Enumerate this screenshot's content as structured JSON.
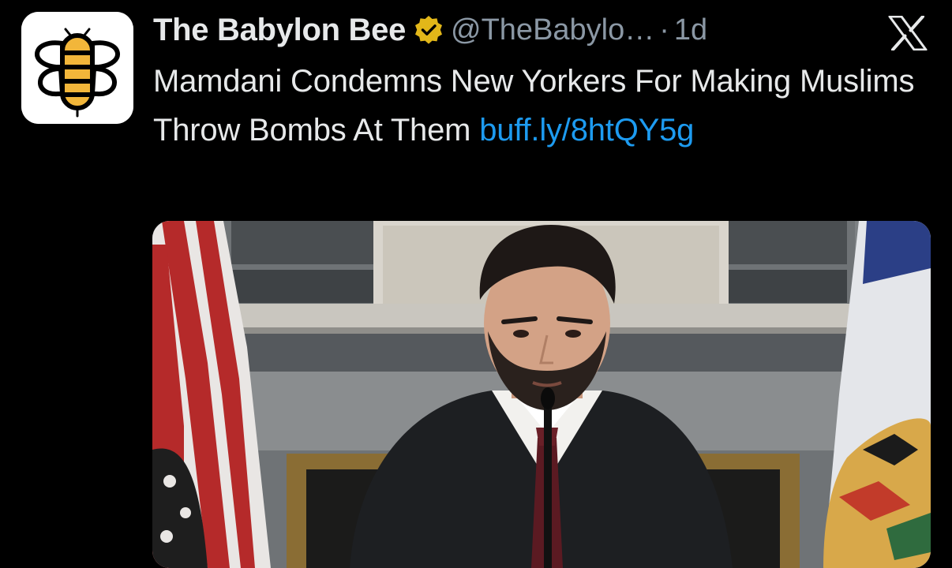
{
  "tweet": {
    "display_name": "The Babylon Bee",
    "handle": "@TheBabylo…",
    "separator": "·",
    "time": "1d",
    "text_main": "Mamdani Condemns New Yorkers For Making Muslims Throw Bombs At Them ",
    "link_text": "buff.ly/​8htQY5g"
  },
  "icons": {
    "avatar": "babylon-bee-logo",
    "verified": "verified-badge-icon",
    "platform": "x-logo-icon"
  },
  "colors": {
    "background": "#000000",
    "text": "#e7e9ea",
    "secondary": "#8b98a5",
    "link": "#1d9bf0",
    "verified_gold": "#e2b719"
  }
}
